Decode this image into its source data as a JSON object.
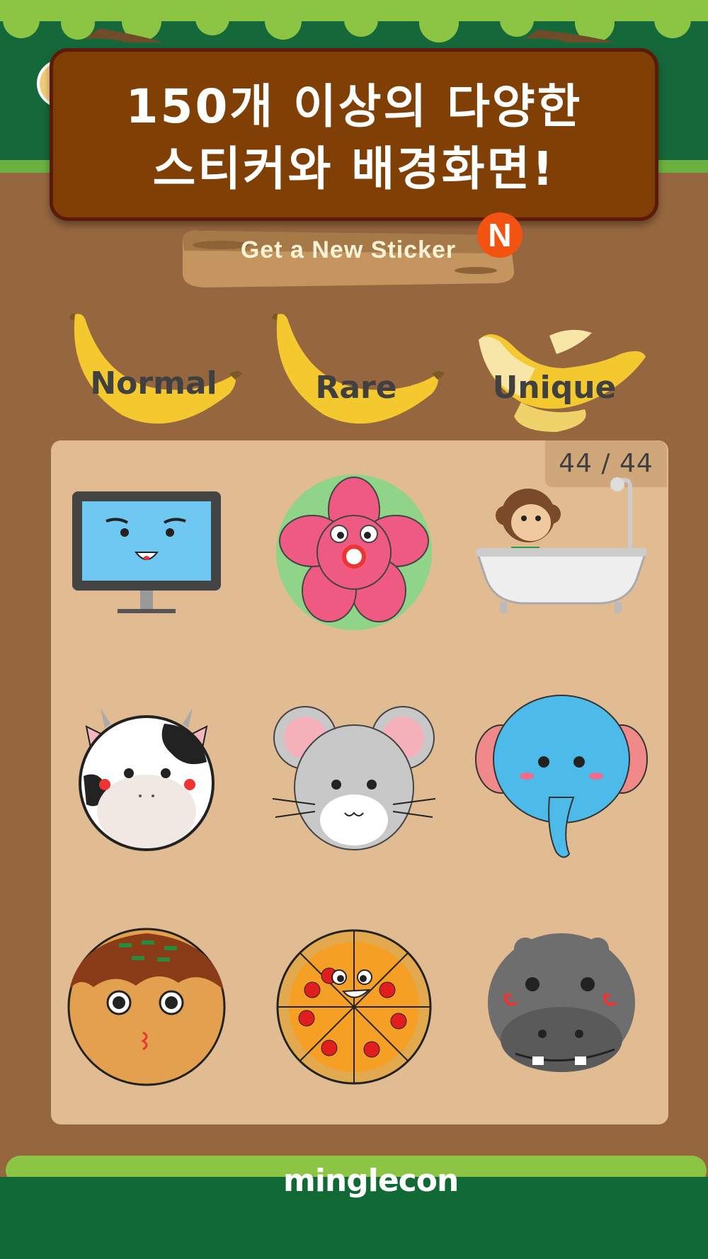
{
  "banner": {
    "line1": "150개 이상의 다양한",
    "line2": "스티커와 배경화면!"
  },
  "new_sticker": {
    "label": "Get a New Sticker",
    "badge": "N"
  },
  "categories": [
    {
      "label": "Normal"
    },
    {
      "label": "Rare"
    },
    {
      "label": "Unique"
    }
  ],
  "collection": {
    "counter": "44 / 44",
    "stickers": [
      {
        "name": "monitor-face"
      },
      {
        "name": "flower"
      },
      {
        "name": "monkey-bathtub"
      },
      {
        "name": "cow"
      },
      {
        "name": "mouse"
      },
      {
        "name": "elephant"
      },
      {
        "name": "takoyaki"
      },
      {
        "name": "pizza"
      },
      {
        "name": "hippo"
      }
    ]
  },
  "footer": {
    "logo": "minglecon"
  },
  "colors": {
    "banner_bg": "#803f04",
    "wood_bg": "#96673f",
    "panel_bg": "#e1bc92",
    "forest_green": "#15683a",
    "grass": "#8cc443",
    "banana": "#f4c930",
    "badge": "#f25310"
  }
}
